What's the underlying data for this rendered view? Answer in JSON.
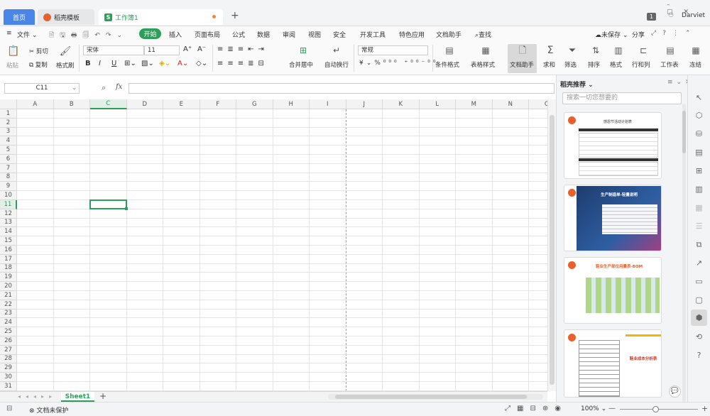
{
  "titlebar": {
    "tabs": [
      {
        "label": "首页"
      },
      {
        "label": "稻壳模板"
      },
      {
        "label": "工作簿1"
      }
    ],
    "new_tab": "+",
    "badge": "1",
    "user": "Darviet"
  },
  "menu": {
    "file": "文件",
    "start": "开始",
    "items": [
      "插入",
      "页面布局",
      "公式",
      "数据",
      "审阅",
      "视图",
      "安全",
      "开发工具",
      "特色应用",
      "文档助手"
    ],
    "search": "查找",
    "unsaved": "未保存",
    "share": "分享"
  },
  "ribbon": {
    "paste": "粘贴",
    "cut": "剪切",
    "copy": "复制",
    "format_painter": "格式刷",
    "font_name": "宋体",
    "font_size": "11",
    "merge_center": "合并居中",
    "wrap_text": "自动换行",
    "number_format": "常规",
    "conditional_format": "条件格式",
    "table_style": "表格样式",
    "doc_assistant": "文档助手",
    "sum": "求和",
    "filter": "筛选",
    "sort": "排序",
    "format": "格式",
    "row_col": "行和列",
    "worksheet": "工作表",
    "freeze": "冻结"
  },
  "formula": {
    "cell_ref": "C11",
    "fx": "fx"
  },
  "grid": {
    "columns": [
      "A",
      "B",
      "C",
      "D",
      "E",
      "F",
      "G",
      "H",
      "I",
      "J",
      "K",
      "L",
      "M",
      "N",
      "O"
    ],
    "rows": [
      "1",
      "2",
      "3",
      "4",
      "5",
      "6",
      "7",
      "8",
      "9",
      "10",
      "11",
      "12",
      "13",
      "14",
      "15",
      "16",
      "17",
      "18",
      "19",
      "20",
      "21",
      "22",
      "23",
      "24",
      "25",
      "26",
      "27",
      "28",
      "29",
      "30",
      "31"
    ],
    "selected_col": "C",
    "selected_row": "11"
  },
  "sheets": {
    "active": "Sheet1",
    "add": "+"
  },
  "status": {
    "protect": "文档未保护",
    "zoom": "100%"
  },
  "panel": {
    "title": "稻壳推荐",
    "search_placeholder": "搜索一切您想要的",
    "cards": [
      {
        "title": "感恩节活动计划表"
      },
      {
        "title": "生产制造单-轻量说明"
      },
      {
        "title": "鞋业生产部位用量表-BOM"
      },
      {
        "title": "鞋业成本分析表"
      }
    ]
  },
  "colors": {
    "accent_green": "#2e9e5b",
    "tab_blue": "#4a86e8",
    "wps_orange": "#e8612c"
  }
}
